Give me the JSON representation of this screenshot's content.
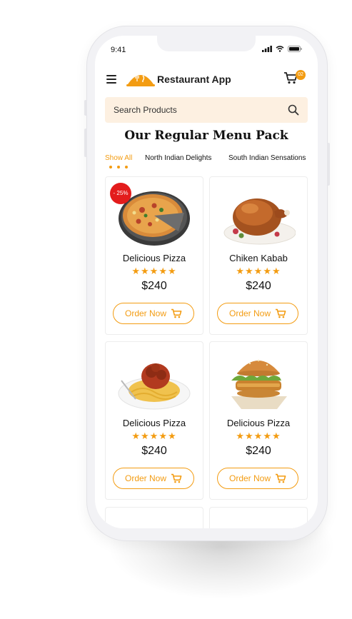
{
  "status": {
    "time": "9:41"
  },
  "header": {
    "title": "Restaurant App",
    "cart_count": "02"
  },
  "search": {
    "placeholder": "Search Products"
  },
  "section": {
    "title": "Our Regular Menu Pack"
  },
  "tabs": [
    {
      "label": "Show All",
      "active": true
    },
    {
      "label": "North Indian Delights",
      "active": false
    },
    {
      "label": "South Indian Sensations",
      "active": false
    }
  ],
  "products": [
    {
      "name": "Delicious Pizza",
      "stars": "★★★★★",
      "rating": 5,
      "price": "$240",
      "button": "Order Now",
      "badge": "- 25%",
      "image": "pizza"
    },
    {
      "name": "Chiken Kabab",
      "stars": "★★★★★",
      "rating": 5,
      "price": "$240",
      "button": "Order Now",
      "image": "roast-chicken"
    },
    {
      "name": "Delicious Pizza",
      "stars": "★★★★★",
      "rating": 5,
      "price": "$240",
      "button": "Order Now",
      "image": "spaghetti"
    },
    {
      "name": "Delicious Pizza",
      "stars": "★★★★★",
      "rating": 5,
      "price": "$240",
      "button": "Order Now",
      "image": "burger"
    }
  ],
  "colors": {
    "accent": "#f39c12",
    "badge": "#e31c1c",
    "search_bg": "#fdf0e1"
  }
}
